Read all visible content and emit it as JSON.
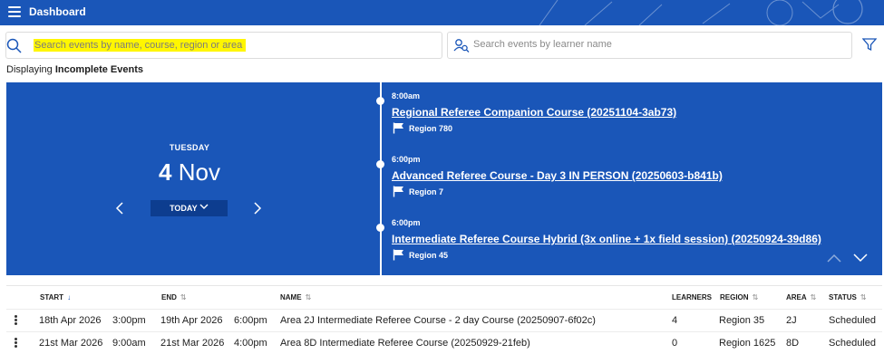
{
  "header": {
    "title": "Dashboard",
    "menu_icon": "hamburger-menu-icon"
  },
  "search": {
    "events_placeholder": "Search events by name, course, region or area",
    "learner_placeholder": "Search events by learner name",
    "filter_icon": "filter-funnel-icon"
  },
  "displaying": {
    "prefix": "Displaying",
    "value": "Incomplete Events"
  },
  "day_view": {
    "weekday": "TUESDAY",
    "day": "4",
    "month": "Nov",
    "today_label": "TODAY",
    "prev_icon": "chevron-left-icon",
    "next_icon": "chevron-right-icon"
  },
  "events": [
    {
      "time": "8:00am",
      "name": "Regional Referee Companion Course (20251104-3ab73)",
      "region": "Region 780"
    },
    {
      "time": "6:00pm",
      "name": "Advanced Referee Course - Day 3 IN PERSON (20250603-b841b)",
      "region": "Region 7"
    },
    {
      "time": "6:00pm",
      "name": "Intermediate Referee Course Hybrid (3x online + 1x field session) (20250924-39d86)",
      "region": "Region 45"
    }
  ],
  "table": {
    "columns": {
      "start": "START",
      "end": "END",
      "name": "NAME",
      "learners": "LEARNERS",
      "region": "REGION",
      "area": "AREA",
      "status": "STATUS"
    },
    "rows": [
      {
        "start_date": "18th Apr 2026",
        "start_time": "3:00pm",
        "end_date": "19th Apr 2026",
        "end_time": "6:00pm",
        "name": "Area 2J Intermediate Referee Course - 2 day Course (20250907-6f02c)",
        "learners": "4",
        "region": "Region 35",
        "area": "2J",
        "status": "Scheduled"
      },
      {
        "start_date": "21st Mar 2026",
        "start_time": "9:00am",
        "end_date": "21st Mar 2026",
        "end_time": "4:00pm",
        "name": "Area 8D Intermediate Referee Course (20250929-21feb)",
        "learners": "0",
        "region": "Region 1625",
        "area": "8D",
        "status": "Scheduled"
      }
    ]
  },
  "colors": {
    "brand_blue": "#1a56b8",
    "today_button": "#0d3d8f",
    "highlight": "#fff600"
  }
}
